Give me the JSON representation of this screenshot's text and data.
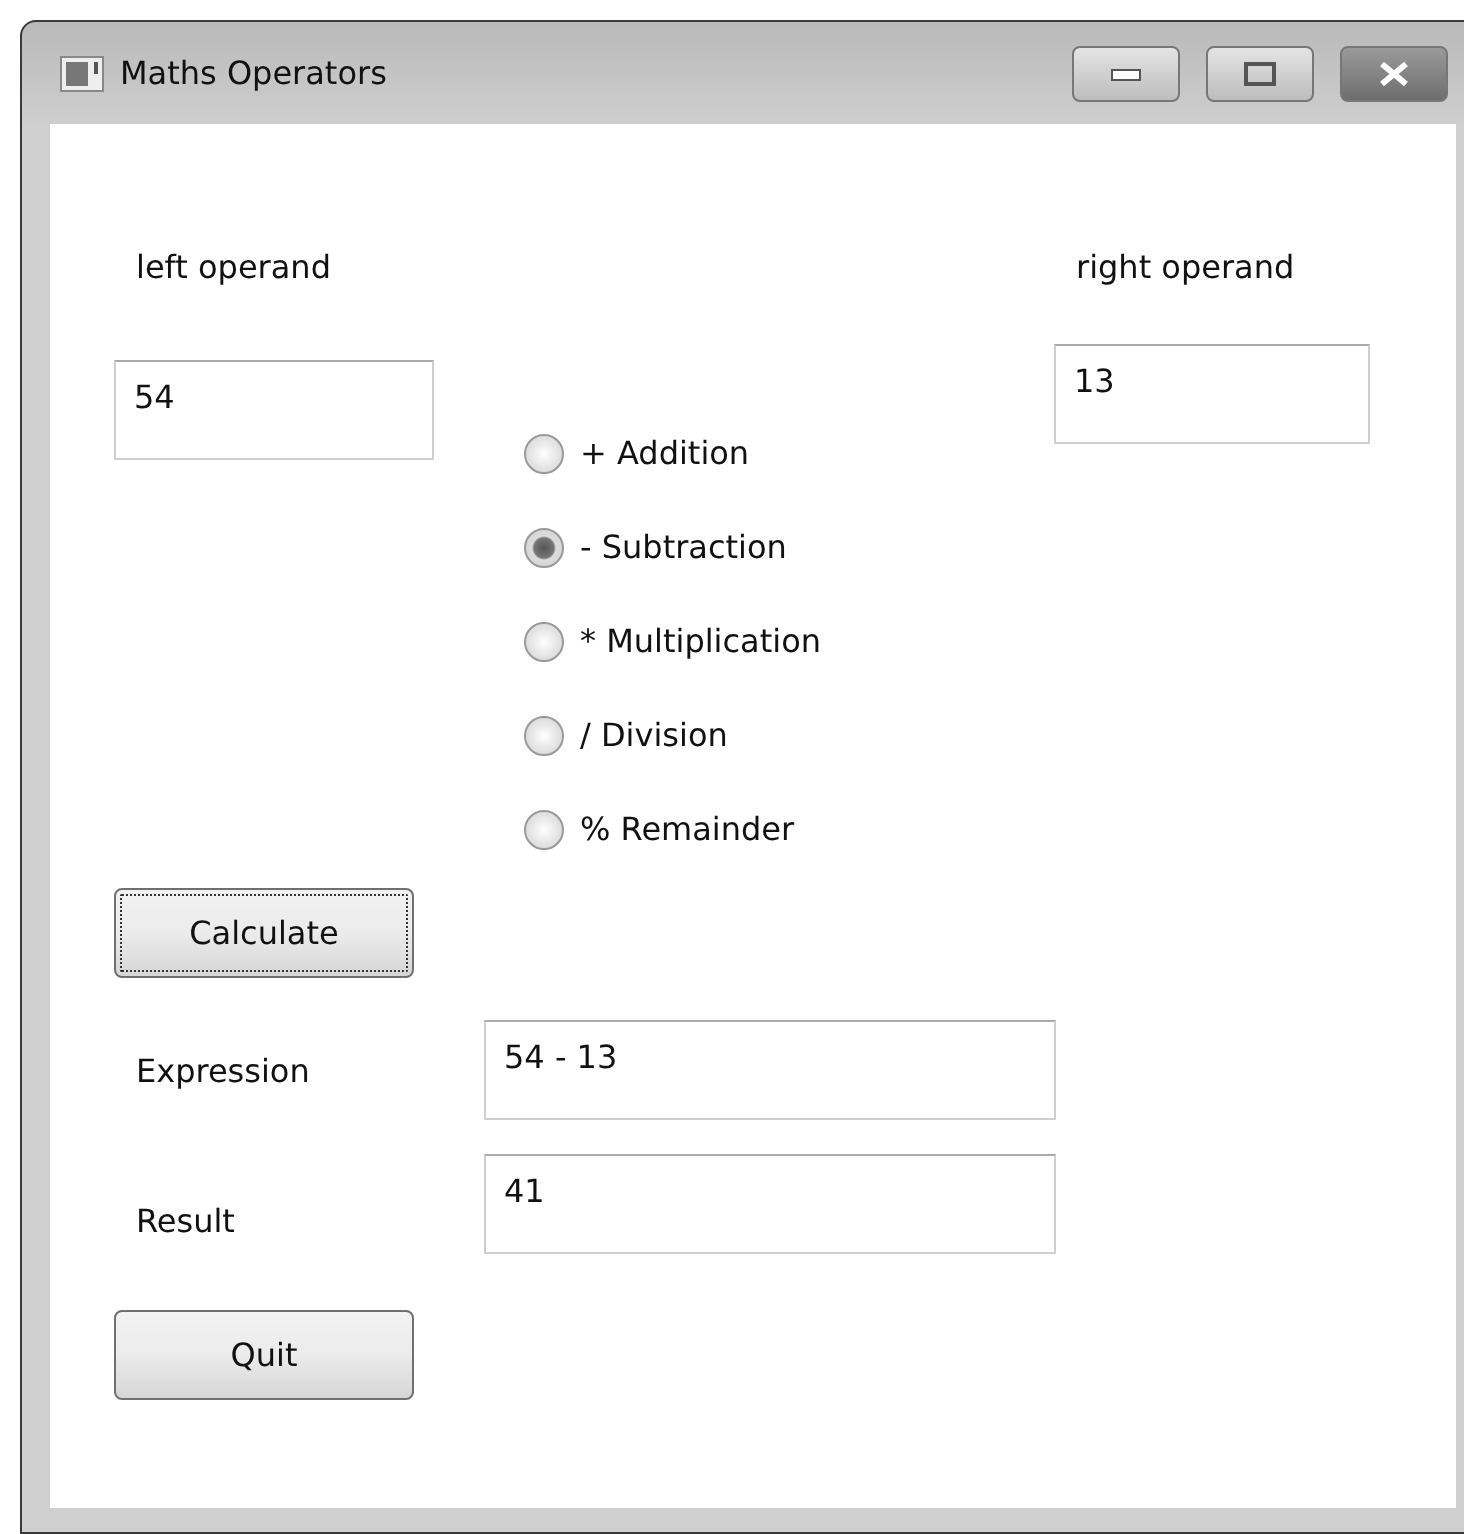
{
  "window": {
    "title": "Maths Operators"
  },
  "left_operand": {
    "label": "left operand",
    "value": "54"
  },
  "right_operand": {
    "label": "right operand",
    "value": "13"
  },
  "operations": [
    {
      "label": "+ Addition",
      "selected": false
    },
    {
      "label": "- Subtraction",
      "selected": true
    },
    {
      "label": "* Multiplication",
      "selected": false
    },
    {
      "label": "/ Division",
      "selected": false
    },
    {
      "label": "% Remainder",
      "selected": false
    }
  ],
  "calculate_button": {
    "label": "Calculate",
    "focused": true
  },
  "expression": {
    "label": "Expression",
    "value": "54 - 13"
  },
  "result": {
    "label": "Result",
    "value": "41"
  },
  "quit_button": {
    "label": "Quit",
    "focused": false
  }
}
